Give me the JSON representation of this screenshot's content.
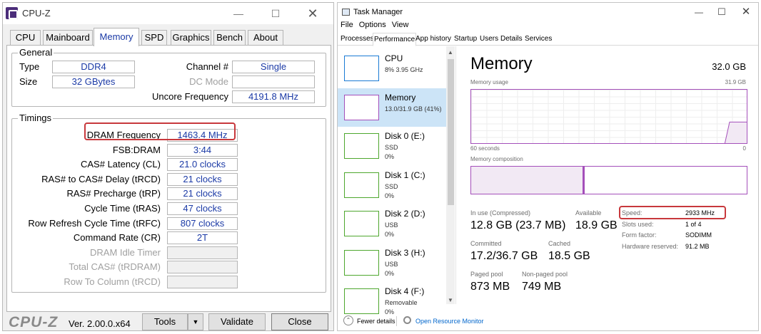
{
  "cpuz": {
    "title": "CPU-Z",
    "tabs": [
      "CPU",
      "Mainboard",
      "Memory",
      "SPD",
      "Graphics",
      "Bench",
      "About"
    ],
    "general": {
      "heading": "General",
      "type_label": "Type",
      "type": "DDR4",
      "size_label": "Size",
      "size": "32 GBytes",
      "channel_label": "Channel #",
      "channel": "Single",
      "dcmode_label": "DC Mode",
      "dcmode": "",
      "uncore_label": "Uncore Frequency",
      "uncore": "4191.8 MHz"
    },
    "timings": {
      "heading": "Timings",
      "rows": [
        {
          "label": "DRAM Frequency",
          "value": "1463.4 MHz",
          "enabled": true
        },
        {
          "label": "FSB:DRAM",
          "value": "3:44",
          "enabled": true
        },
        {
          "label": "CAS# Latency (CL)",
          "value": "21.0 clocks",
          "enabled": true
        },
        {
          "label": "RAS# to CAS# Delay (tRCD)",
          "value": "21 clocks",
          "enabled": true
        },
        {
          "label": "RAS# Precharge (tRP)",
          "value": "21 clocks",
          "enabled": true
        },
        {
          "label": "Cycle Time (tRAS)",
          "value": "47 clocks",
          "enabled": true
        },
        {
          "label": "Row Refresh Cycle Time (tRFC)",
          "value": "807 clocks",
          "enabled": true
        },
        {
          "label": "Command Rate (CR)",
          "value": "2T",
          "enabled": true
        },
        {
          "label": "DRAM Idle Timer",
          "value": "",
          "enabled": false
        },
        {
          "label": "Total CAS# (tRDRAM)",
          "value": "",
          "enabled": false
        },
        {
          "label": "Row To Column (tRCD)",
          "value": "",
          "enabled": false
        }
      ]
    },
    "footer": {
      "logo": "CPU-Z",
      "version": "Ver. 2.00.0.x64",
      "tools": "Tools",
      "validate": "Validate",
      "close": "Close"
    },
    "highlight_color": "#c8383c"
  },
  "taskmgr": {
    "title": "Task Manager",
    "menu": [
      "File",
      "Options",
      "View"
    ],
    "tabs": [
      "Processes",
      "Performance",
      "App history",
      "Startup",
      "Users",
      "Details",
      "Services"
    ],
    "sidebar": [
      {
        "name": "CPU",
        "sub1": "8%  3.95 GHz",
        "sub2": "",
        "color": "#1a7ad4"
      },
      {
        "name": "Memory",
        "sub1": "13.0/31.9 GB (41%)",
        "sub2": "",
        "color": "#a44fba"
      },
      {
        "name": "Disk 0 (E:)",
        "sub1": "SSD",
        "sub2": "0%",
        "color": "#4ea72e"
      },
      {
        "name": "Disk 1 (C:)",
        "sub1": "SSD",
        "sub2": "0%",
        "color": "#4ea72e"
      },
      {
        "name": "Disk 2 (D:)",
        "sub1": "USB",
        "sub2": "0%",
        "color": "#4ea72e"
      },
      {
        "name": "Disk 3 (H:)",
        "sub1": "USB",
        "sub2": "0%",
        "color": "#4ea72e"
      },
      {
        "name": "Disk 4 (F:)",
        "sub1": "Removable",
        "sub2": "0%",
        "color": "#4ea72e"
      }
    ],
    "main": {
      "heading": "Memory",
      "total": "32.0 GB",
      "usage_label": "Memory usage",
      "usage_max": "31.9 GB",
      "time_left": "60 seconds",
      "time_right": "0",
      "composition_label": "Memory composition",
      "stats": {
        "inuse_label": "In use (Compressed)",
        "inuse": "12.8 GB (23.7 MB)",
        "available_label": "Available",
        "available": "18.9 GB",
        "committed_label": "Committed",
        "committed": "17.2/36.7 GB",
        "cached_label": "Cached",
        "cached": "18.5 GB",
        "paged_label": "Paged pool",
        "paged": "873 MB",
        "nonpaged_label": "Non-paged pool",
        "nonpaged": "749 MB"
      },
      "details": [
        {
          "label": "Speed:",
          "value": "2933 MHz"
        },
        {
          "label": "Slots used:",
          "value": "1 of 4"
        },
        {
          "label": "Form factor:",
          "value": "SODIMM"
        },
        {
          "label": "Hardware reserved:",
          "value": "91.2 MB"
        }
      ],
      "usage_fraction": 0.41
    },
    "footer": {
      "fewer_details": "Fewer details",
      "open_monitor": "Open Resource Monitor"
    },
    "accent_memory": "#a44fba",
    "link_color": "#0066cc"
  }
}
